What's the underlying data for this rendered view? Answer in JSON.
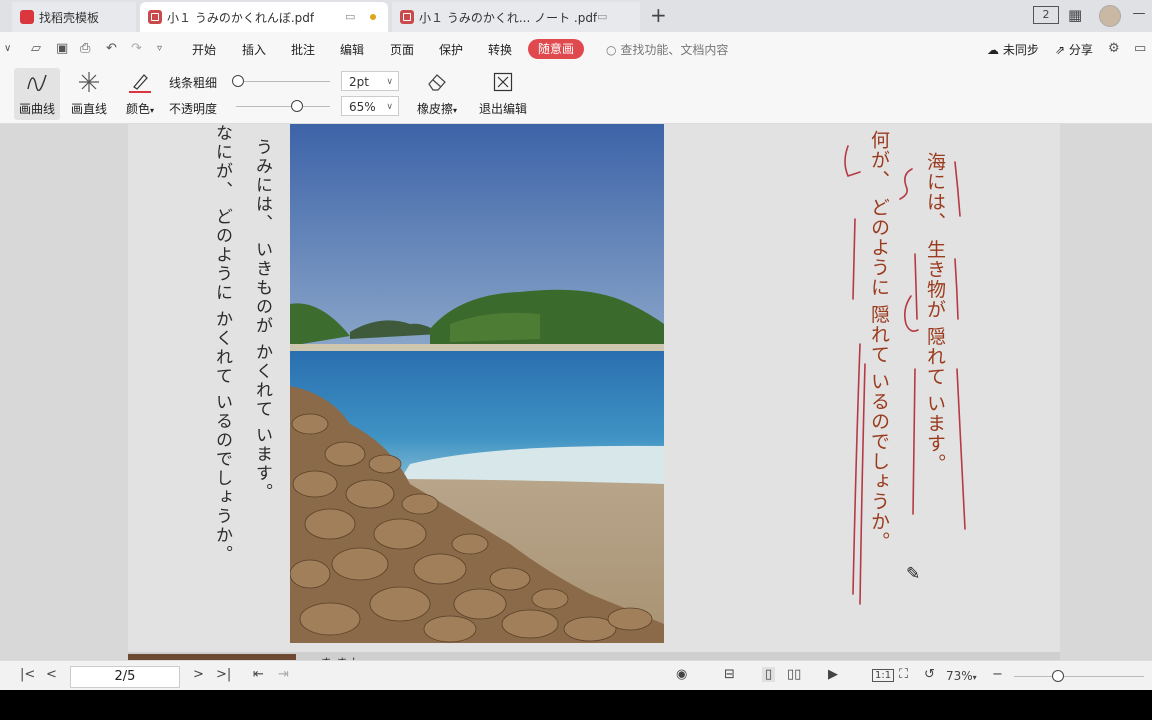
{
  "tabs": [
    {
      "label": "找稻壳模板",
      "icon": "docer-logo-icon"
    },
    {
      "label": "小１ うみのかくれんぼ.pdf",
      "icon": "pdf-icon",
      "active": true
    },
    {
      "label": "小１ うみのかくれ... ノート .pdf",
      "icon": "pdf-icon"
    }
  ],
  "window": {
    "badge": "2"
  },
  "menu": {
    "items": [
      "开始",
      "插入",
      "批注",
      "编辑",
      "页面",
      "保护",
      "转换"
    ],
    "active_item": "随意画",
    "search_placeholder": "查找功能、文档内容",
    "sync_label": "未同步",
    "share_label": "分享"
  },
  "toolbar": {
    "curve_label": "画曲线",
    "line_label": "画直线",
    "color_label": "颜色",
    "accent_color": "#d9363e",
    "thickness_label": "线条粗细",
    "thickness_value": "2pt",
    "thickness_level": 0.02,
    "opacity_label": "不透明度",
    "opacity_value": "65%",
    "opacity_level": 0.65,
    "eraser_label": "橡皮擦",
    "exit_label": "退出编辑"
  },
  "document": {
    "printed_lines": [
      "うみには、 いきものが かくれて います。",
      "なにが、 どのように かくれて いるのでしょうか。"
    ],
    "handwritten_lines": [
      "海には、 生き物が 隠れて います。",
      "何が、 どのように 隠れて いるのでしょうか。"
    ],
    "bottom_text": "ま  ま  |"
  },
  "statusbar": {
    "page_value": "2/5",
    "zoom_value": "73%",
    "zoom_level": 0.73
  }
}
